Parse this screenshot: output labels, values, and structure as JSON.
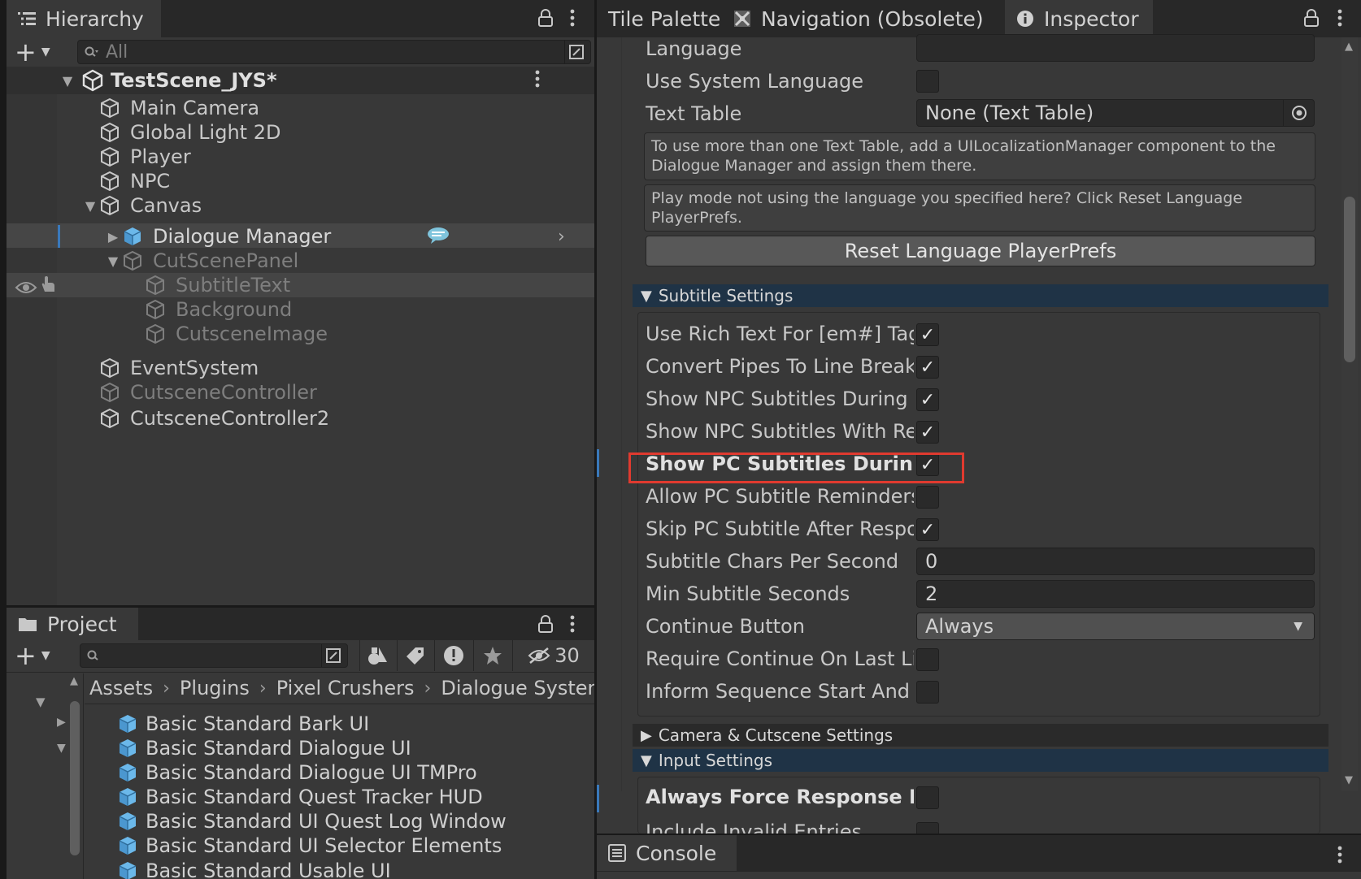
{
  "hierarchy": {
    "tab_label": "Hierarchy",
    "search_placeholder": "All",
    "scene": "TestScene_JYS*",
    "items": [
      {
        "label": "Main Camera"
      },
      {
        "label": "Global Light 2D"
      },
      {
        "label": "Player"
      },
      {
        "label": "NPC"
      },
      {
        "label": "Canvas"
      },
      {
        "label": "Dialogue Manager"
      },
      {
        "label": "CutScenePanel"
      },
      {
        "label": "SubtitleText"
      },
      {
        "label": "Background"
      },
      {
        "label": "CutsceneImage"
      },
      {
        "label": "EventSystem"
      },
      {
        "label": "CutsceneController"
      },
      {
        "label": "CutsceneController2"
      }
    ]
  },
  "inspector_tabs": {
    "tile_palette": "Tile Palette",
    "navigation": "Navigation (Obsolete)",
    "inspector": "Inspector"
  },
  "inspector": {
    "language_label": "Language",
    "language_value": "",
    "use_system_language_label": "Use System Language",
    "text_table_label": "Text Table",
    "text_table_value": "None (Text Table)",
    "help1": "To use more than one Text Table, add a UILocalizationManager component to the Dialogue Manager and assign them there.",
    "help2": "Play mode not using the language you specified here? Click Reset Language PlayerPrefs.",
    "reset_button": "Reset Language PlayerPrefs",
    "subtitle_settings": "Subtitle Settings",
    "rows": [
      {
        "label": "Use Rich Text For [em#] Tags",
        "checked": "✓"
      },
      {
        "label": "Convert Pipes To Line Breaks",
        "checked": "✓"
      },
      {
        "label": "Show NPC Subtitles During Li",
        "checked": "✓"
      },
      {
        "label": "Show NPC Subtitles With Res",
        "checked": "✓"
      },
      {
        "label": "Show PC Subtitles During Li",
        "checked": "✓"
      },
      {
        "label": "Allow PC Subtitle Reminders",
        "checked": ""
      },
      {
        "label": "Skip PC Subtitle After Respon",
        "checked": "✓"
      }
    ],
    "chars_per_second_label": "Subtitle Chars Per Second",
    "chars_per_second_value": "0",
    "min_seconds_label": "Min Subtitle Seconds",
    "min_seconds_value": "2",
    "continue_button_label": "Continue Button",
    "continue_button_value": "Always",
    "require_continue_label": "Require Continue On Last Line",
    "inform_sequence_label": "Inform Sequence Start And End",
    "camera_settings": "Camera & Cutscene Settings",
    "input_settings": "Input Settings",
    "always_force_label": "Always Force Response Menu",
    "include_invalid_label": "Include Invalid Entries"
  },
  "highlight_color": "#e03a2f",
  "project": {
    "tab_label": "Project",
    "hidden_count": "30",
    "breadcrumb": [
      "Assets",
      "Plugins",
      "Pixel Crushers",
      "Dialogue System"
    ],
    "items": [
      {
        "label": "Basic Standard Bark UI"
      },
      {
        "label": "Basic Standard Dialogue UI"
      },
      {
        "label": "Basic Standard Dialogue UI TMPro"
      },
      {
        "label": "Basic Standard Quest Tracker HUD"
      },
      {
        "label": "Basic Standard UI Quest Log Window"
      },
      {
        "label": "Basic Standard UI Selector Elements"
      },
      {
        "label": "Basic Standard Usable UI"
      }
    ]
  },
  "console": {
    "tab_label": "Console"
  }
}
